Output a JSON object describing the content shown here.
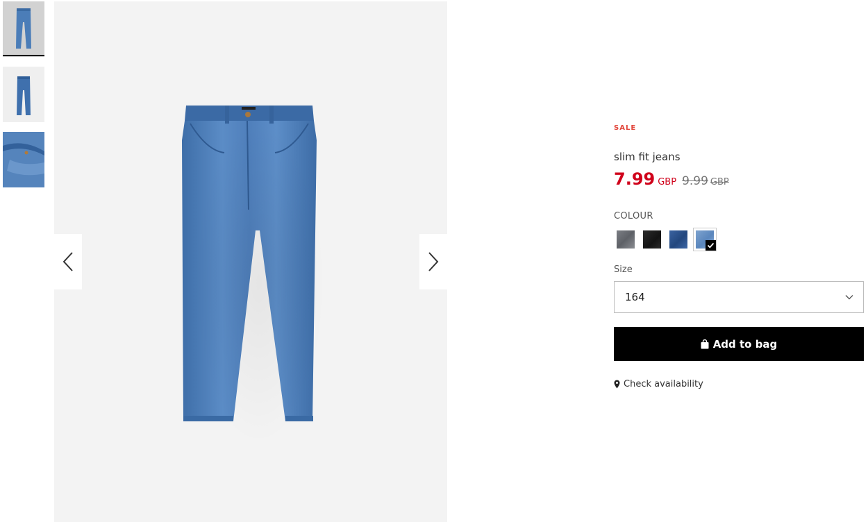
{
  "gallery": {
    "thumbnails": [
      "jeans-front-thumbnail",
      "jeans-back-thumbnail",
      "jeans-detail-thumbnail"
    ],
    "selected_index": 0,
    "prev_icon": "chevron-left-icon",
    "next_icon": "chevron-right-icon"
  },
  "product": {
    "badge": "SALE",
    "title": "slim fit jeans",
    "price_now": "7.99",
    "currency_now": "GBP",
    "price_old": "9.99",
    "currency_old": "GBP",
    "accent_color": "#d0021b",
    "badge_color": "#e2463b"
  },
  "colour": {
    "label": "COLOUR",
    "options": [
      {
        "name": "grey-swatch",
        "color": "#6b6e74"
      },
      {
        "name": "black-swatch",
        "color": "#1c1c1c"
      },
      {
        "name": "dark-blue-swatch",
        "color": "#2d548f"
      },
      {
        "name": "light-blue-swatch",
        "color": "#6d95c6"
      }
    ],
    "selected_index": 3
  },
  "size": {
    "label": "Size",
    "value": "164"
  },
  "actions": {
    "add_to_bag": "Add to bag",
    "check_availability": "Check availability"
  }
}
